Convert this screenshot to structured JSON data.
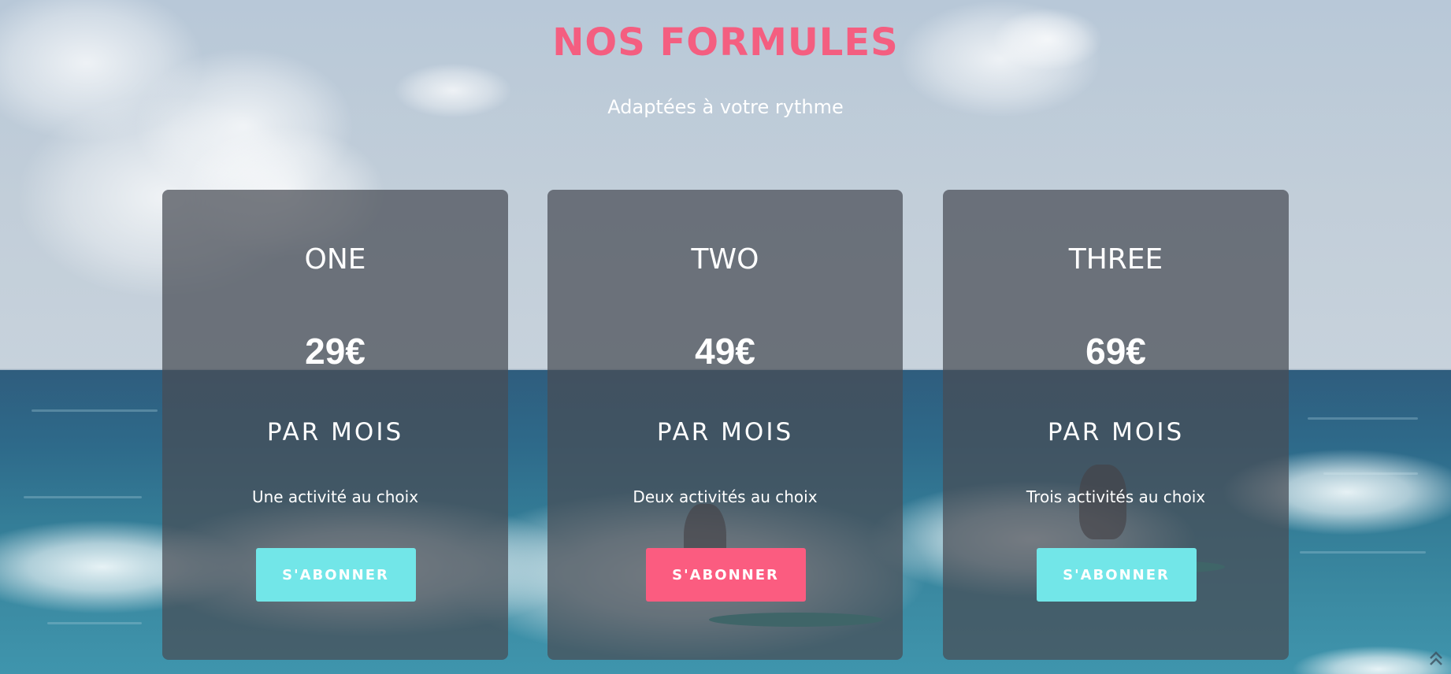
{
  "section": {
    "title": "NOS FORMULES",
    "subtitle": "Adaptées à votre rythme"
  },
  "plans": [
    {
      "name": "ONE",
      "price": "29€",
      "period": "PAR MOIS",
      "description": "Une activité au choix",
      "cta": "S'ABONNER",
      "cta_color": "#72e6e8"
    },
    {
      "name": "TWO",
      "price": "49€",
      "period": "PAR MOIS",
      "description": "Deux activités au choix",
      "cta": "S'ABONNER",
      "cta_color": "#fb5c80"
    },
    {
      "name": "THREE",
      "price": "69€",
      "period": "PAR MOIS",
      "description": "Trois activités au choix",
      "cta": "S'ABONNER",
      "cta_color": "#72e6e8"
    }
  ],
  "colors": {
    "accent": "#f45e80",
    "teal": "#72e6e8",
    "pink": "#fb5c80",
    "card_overlay": "rgba(72,76,84,0.72)"
  },
  "icons": {
    "scroll_top": "double-chevron-up-icon"
  }
}
